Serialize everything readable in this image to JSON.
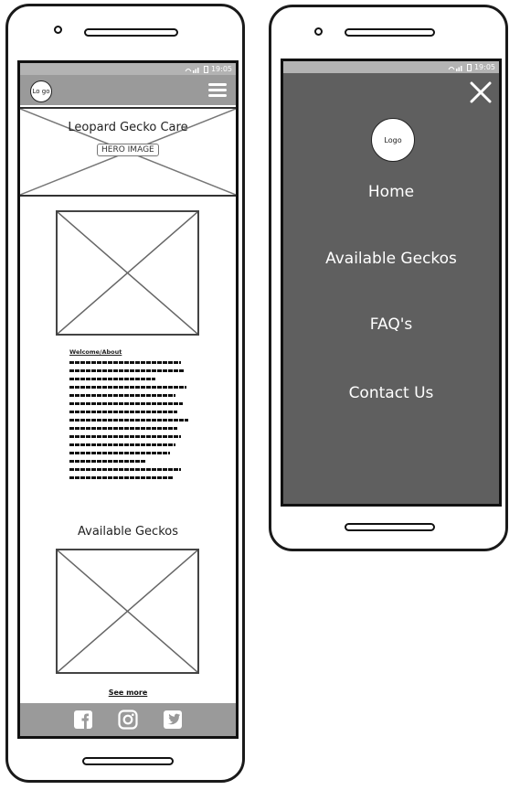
{
  "status_bar": {
    "time": "19:05"
  },
  "mobile_home": {
    "logo_text": "Lo go",
    "hero": {
      "title": "Leopard Gecko Care",
      "label": "HERO IMAGE"
    },
    "about": {
      "heading": "Welcome/About"
    },
    "geckos": {
      "heading": "Available Geckos",
      "see_more": "See more"
    },
    "footer": {
      "icons": [
        "facebook-icon",
        "instagram-icon",
        "twitter-icon"
      ]
    }
  },
  "mobile_menu": {
    "logo_text": "Logo",
    "items": [
      "Home",
      "Available Geckos",
      "FAQ's",
      "Contact Us"
    ]
  },
  "colors": {
    "navbar": "#9a9a9a",
    "status_bar": "#b3b3b3",
    "menu_overlay": "#5f5f5f"
  }
}
